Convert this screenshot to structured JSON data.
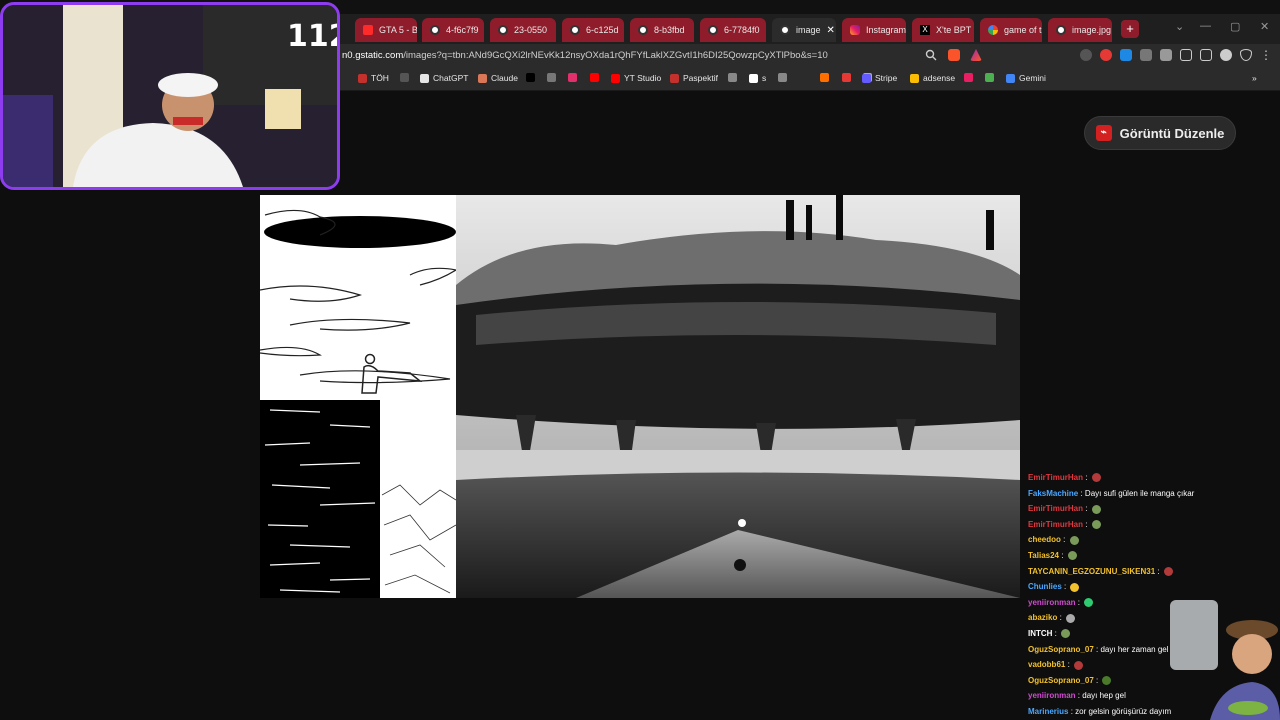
{
  "browser": {
    "tabs": [
      {
        "label": "GTA 5 - B",
        "icon": "youtube-icon",
        "style": "red"
      },
      {
        "label": "4-f6c7f9",
        "icon": "globe-icon",
        "style": "red"
      },
      {
        "label": "23-0550",
        "icon": "globe-icon",
        "style": "red"
      },
      {
        "label": "6-c125d",
        "icon": "globe-icon",
        "style": "red"
      },
      {
        "label": "8-b3fbd",
        "icon": "globe-icon",
        "style": "red"
      },
      {
        "label": "6-7784f0",
        "icon": "globe-icon",
        "style": "red"
      },
      {
        "label": "image",
        "icon": "globe-icon",
        "style": "active"
      },
      {
        "label": "Instagram",
        "icon": "instagram-icon",
        "style": "red"
      },
      {
        "label": "X'te BPT",
        "icon": "x-icon",
        "style": "red"
      },
      {
        "label": "game of t",
        "icon": "google-icon",
        "style": "red"
      },
      {
        "label": "image.jpg",
        "icon": "globe-icon",
        "style": "red"
      }
    ],
    "new_tab": "+",
    "url_host": "n0.gstatic.com",
    "url_rest": "/images?q=tbn:ANd9GcQXi2lrNEvKk12nsyOXda1rQhFYfLaklXZGvtI1h6DI25QowzpCyXTlPbo&s=10",
    "bookmarks": [
      {
        "label": "TÖH",
        "color": "#c4302b"
      },
      {
        "label": "",
        "color": "#555555"
      },
      {
        "label": "ChatGPT",
        "color": "#e6e6e6"
      },
      {
        "label": "Claude",
        "color": "#d97757"
      },
      {
        "label": "",
        "color": "#000000"
      },
      {
        "label": "",
        "color": "#777777"
      },
      {
        "label": "",
        "color": "#e1306c"
      },
      {
        "label": "",
        "color": "#ff0000"
      },
      {
        "label": "YT Studio",
        "color": "#ff0000"
      },
      {
        "label": "Paspektif",
        "color": "#c4302b"
      },
      {
        "label": "",
        "color": "#888888"
      },
      {
        "label": "s",
        "color": "#ffffff"
      },
      {
        "label": "",
        "color": "#888888"
      },
      {
        "label": "",
        "color": "#ff6f00"
      },
      {
        "label": "",
        "color": "#e53935"
      },
      {
        "label": "",
        "color": "#aaaaaa"
      },
      {
        "label": "Stripe",
        "color": "#635bff"
      },
      {
        "label": "adsense",
        "color": "#fbbc04"
      },
      {
        "label": "",
        "color": "#e91e63"
      },
      {
        "label": "",
        "color": "#4caf50"
      },
      {
        "label": "Gemini",
        "color": "#4285f4"
      }
    ]
  },
  "viewer": {
    "edit_button_label": "Görüntü Düzenle",
    "image_title": "image.jpg"
  },
  "stream": {
    "viewer_count": "112",
    "chat": [
      {
        "user": "EmirTimurHan",
        "color": "#e0373f",
        "message": "",
        "emote": "#b23a3a"
      },
      {
        "user": "FaksMachine",
        "color": "#4aa8ff",
        "message": "Dayı sufi gülen ile manga çıkar",
        "emote": ""
      },
      {
        "user": "EmirTimurHan",
        "color": "#e0373f",
        "message": "",
        "emote": "#7a9a5a"
      },
      {
        "user": "EmirTimurHan",
        "color": "#e0373f",
        "message": "",
        "emote": "#7a9a5a"
      },
      {
        "user": "cheedoo",
        "color": "#f2c12e",
        "message": "",
        "emote": "#7a9a5a"
      },
      {
        "user": "Talias24",
        "color": "#f2c12e",
        "message": "",
        "emote": "#7a9a5a"
      },
      {
        "user": "TAYCANIN_EGZOZUNU_SIKEN31",
        "color": "#f2c12e",
        "message": "",
        "emote": "#b23a3a"
      },
      {
        "user": "Chunlies",
        "color": "#4aa8ff",
        "message": "",
        "emote": "#f2c12e"
      },
      {
        "user": "yeniironman",
        "color": "#d14bd1",
        "message": "",
        "emote": "#2ecc71"
      },
      {
        "user": "abaziko",
        "color": "#f2c12e",
        "message": "",
        "emote": "#aaaaaa"
      },
      {
        "user": "INTCH",
        "color": "#ffffff",
        "message": "",
        "emote": "#7a9a5a"
      },
      {
        "user": "OguzSoprano_07",
        "color": "#f2c12e",
        "message": "dayı her zaman gel",
        "emote": ""
      },
      {
        "user": "vadobb61",
        "color": "#f2c12e",
        "message": "",
        "emote": "#b23a3a"
      },
      {
        "user": "OguzSoprano_07",
        "color": "#f2c12e",
        "message": "",
        "emote": "#4b7a2a"
      },
      {
        "user": "yeniironman",
        "color": "#d14bd1",
        "message": "dayı hep gel",
        "emote": ""
      },
      {
        "user": "Marinerius",
        "color": "#4aa8ff",
        "message": "zor gelsin görüşürüz dayım",
        "emote": ""
      }
    ]
  }
}
